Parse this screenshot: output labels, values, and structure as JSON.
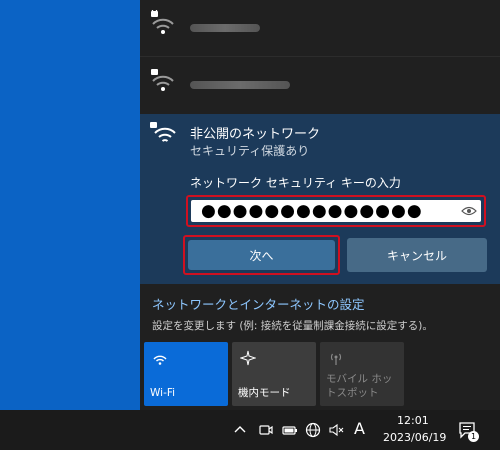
{
  "networks": [
    {
      "name_visible": false
    },
    {
      "name_visible": false
    }
  ],
  "expanded_network": {
    "title": "非公開のネットワーク",
    "security": "セキュリティ保護あり",
    "key_label": "ネットワーク セキュリティ キーの入力",
    "password_mask": "●●●●●●●●●●●●●●",
    "next_label": "次へ",
    "cancel_label": "キャンセル"
  },
  "settings": {
    "title": "ネットワークとインターネットの設定",
    "description": "設定を変更します (例: 接続を従量制課金接続に設定する)。"
  },
  "quick_actions": [
    {
      "label": "Wi-Fi",
      "icon": "wifi-icon",
      "active": true
    },
    {
      "label": "機内モード",
      "icon": "airplane-icon",
      "active": false
    },
    {
      "label": "モバイル ホットスポット",
      "icon": "hotspot-icon",
      "active": false
    }
  ],
  "taskbar": {
    "ime": "A",
    "time": "12:01",
    "date": "2023/06/19",
    "notification_count": "1"
  },
  "colors": {
    "accent": "#0a6bd8",
    "highlight_border": "#d01020",
    "link": "#8ec7ff"
  }
}
